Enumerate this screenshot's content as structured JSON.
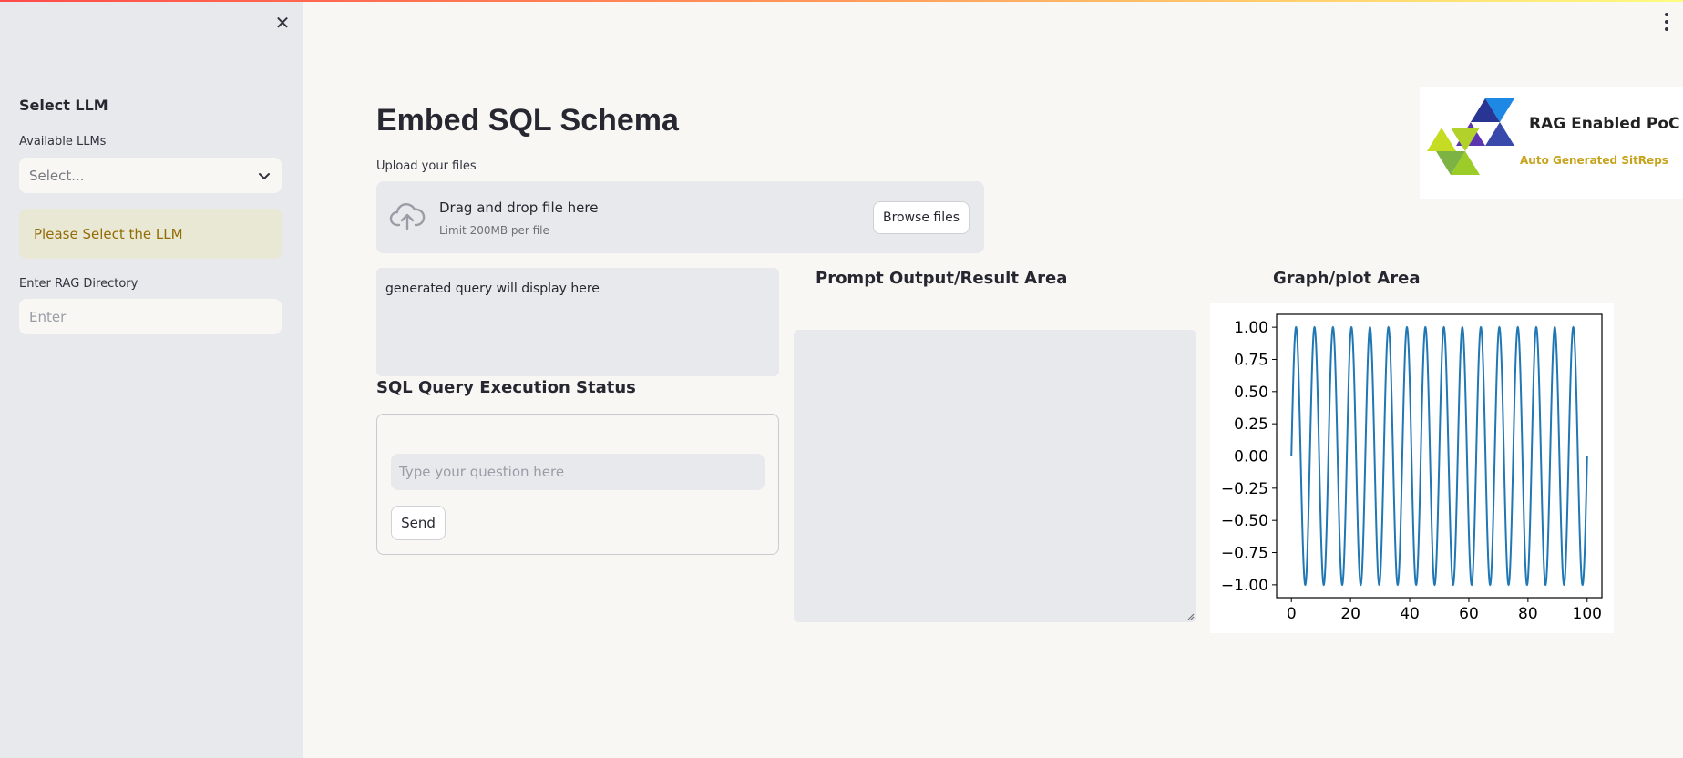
{
  "sidebar": {
    "heading": "Select LLM",
    "llm_label": "Available LLMs",
    "llm_select_value": "Select...",
    "warning": "Please Select the LLM",
    "rag_label": "Enter RAG Directory",
    "rag_placeholder": "Enter"
  },
  "main": {
    "title": "Embed SQL Schema",
    "upload": {
      "label": "Upload your files",
      "drag_text": "Drag and drop file here",
      "limit_text": "Limit 200MB per file",
      "browse_label": "Browse files"
    },
    "query_display": "generated query will display here",
    "sql_status_heading": "SQL Query Execution Status",
    "question_placeholder": "Type your question here",
    "send_label": "Send",
    "output_heading": "Prompt Output/Result Area",
    "plot_heading": "Graph/plot Area"
  },
  "logo": {
    "title": "RAG Enabled PoC",
    "subtitle": "Auto Generated SitReps"
  },
  "colors": {
    "line": "#1f77b4",
    "warning_text": "#926c05",
    "warning_bg": "#e9e8d4"
  },
  "chart_data": {
    "type": "line",
    "function": "sin",
    "x_range": [
      0,
      100
    ],
    "cycles": 16,
    "xlim": [
      0,
      100
    ],
    "ylim": [
      -1.0,
      1.0
    ],
    "xticks": [
      "0",
      "20",
      "40",
      "60",
      "80",
      "100"
    ],
    "yticks": [
      "1.00",
      "0.75",
      "0.50",
      "0.25",
      "0.00",
      "−0.25",
      "−0.50",
      "−0.75",
      "−1.00"
    ],
    "grid": false
  }
}
